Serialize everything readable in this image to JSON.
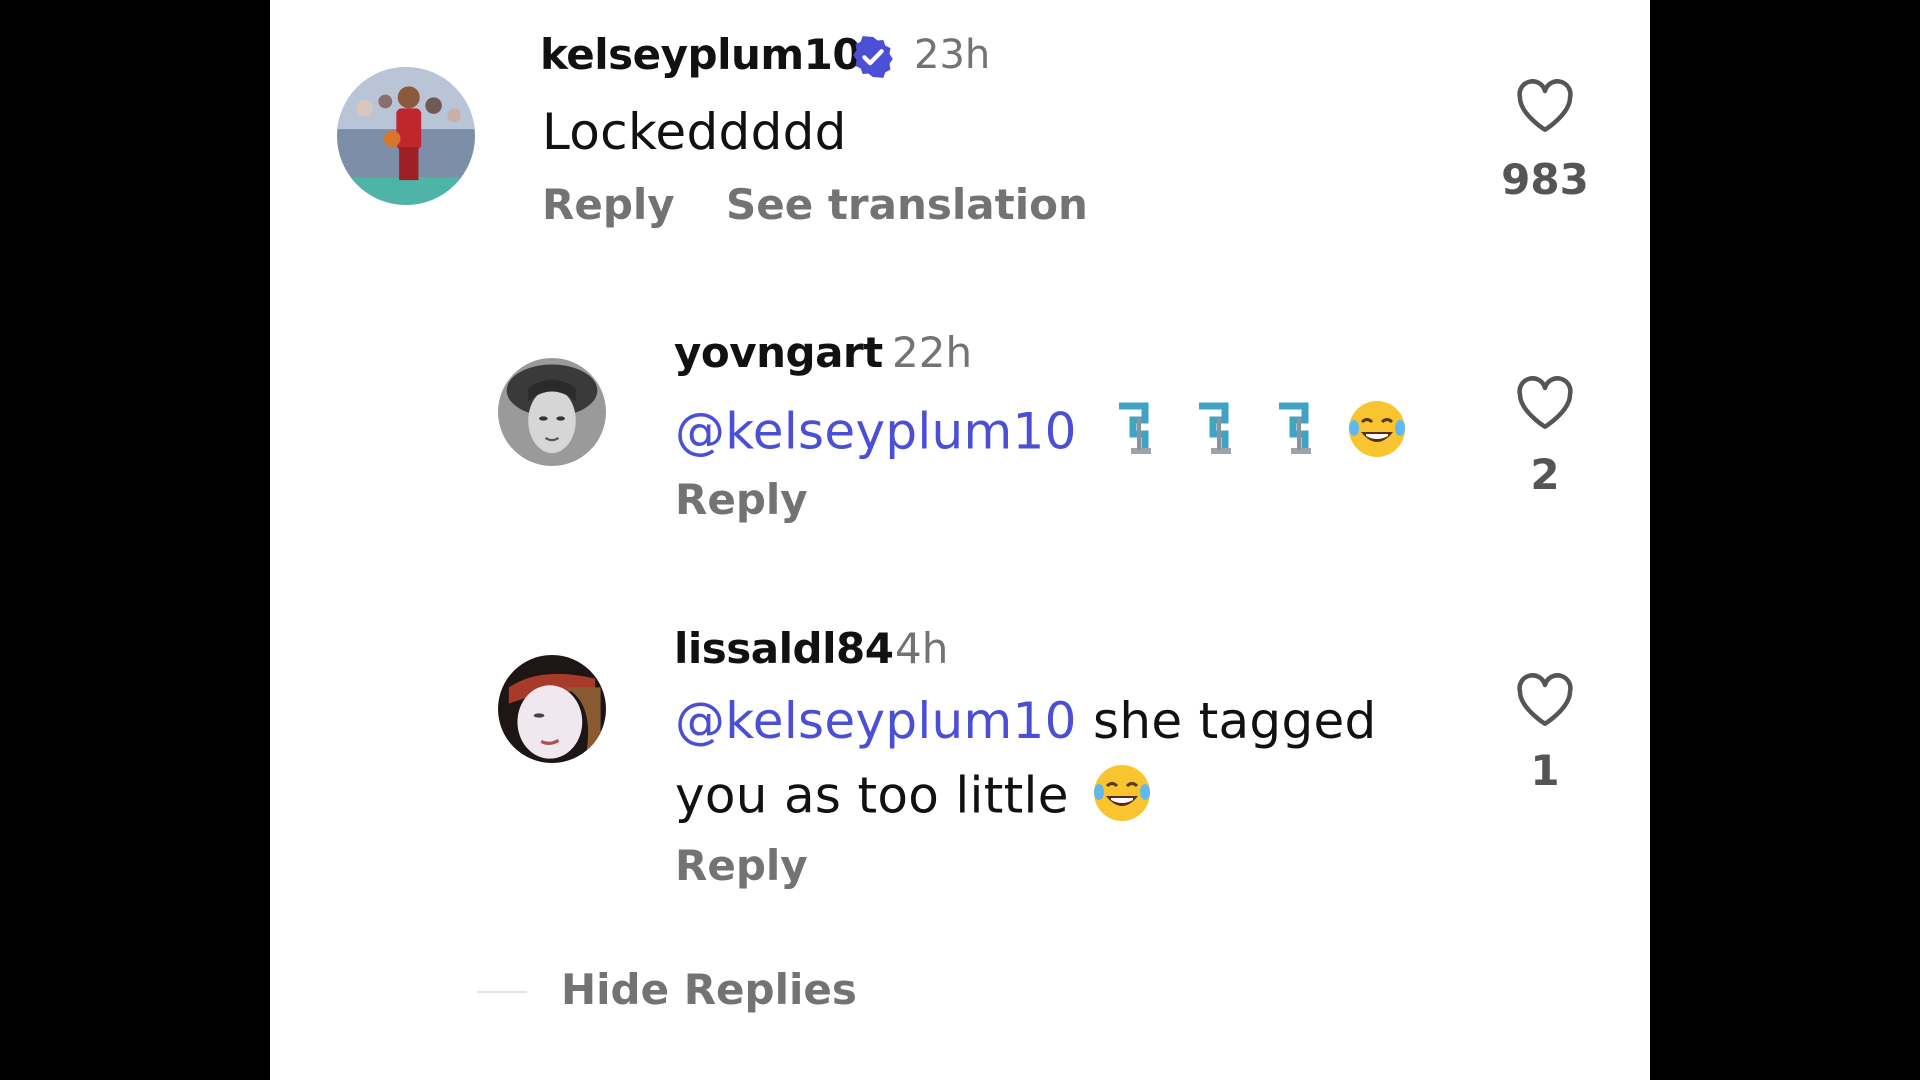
{
  "accent_color": "#4a4fd6",
  "comments": [
    {
      "username": "kelseyplum10",
      "verified": true,
      "time": "23h",
      "text": "Lockeddddd",
      "actions": [
        "Reply",
        "See translation"
      ],
      "likes": "983",
      "avatar": "kelseyplum10-avatar"
    },
    {
      "username": "yovngart",
      "time": "22h",
      "mention": "@kelseyplum10",
      "emojis": [
        "clamp-emoji",
        "clamp-emoji",
        "clamp-emoji",
        "laughing-tears-emoji"
      ],
      "actions": [
        "Reply"
      ],
      "likes": "2",
      "avatar": "yovngart-avatar"
    },
    {
      "username": "lissaldl84",
      "time": "4h",
      "mention": "@kelseyplum10",
      "text_line1": " she tagged",
      "text_line2": "you as too little",
      "emoji": "laughing-tears-emoji",
      "actions": [
        "Reply"
      ],
      "likes": "1",
      "avatar": "lissaldl84-avatar"
    }
  ],
  "hide_replies": "Hide Replies"
}
